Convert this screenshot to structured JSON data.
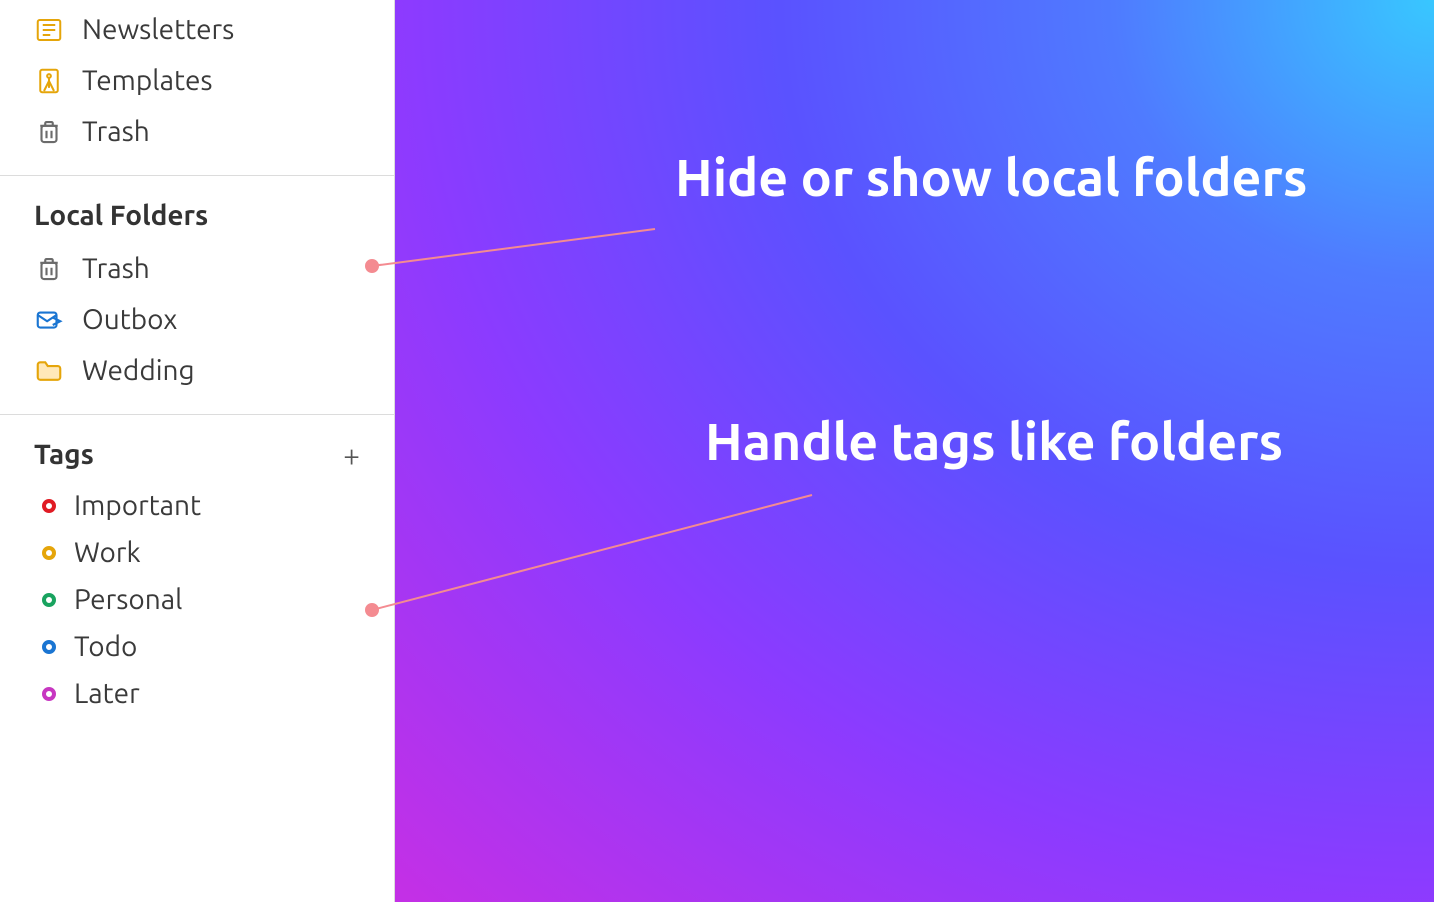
{
  "sidebar": {
    "top_items": [
      {
        "label": "Newsletters",
        "icon": "newsletter"
      },
      {
        "label": "Templates",
        "icon": "template"
      },
      {
        "label": "Trash",
        "icon": "trash"
      }
    ],
    "local_folders": {
      "title": "Local Folders",
      "items": [
        {
          "label": "Trash",
          "icon": "trash"
        },
        {
          "label": "Outbox",
          "icon": "outbox"
        },
        {
          "label": "Wedding",
          "icon": "folder"
        }
      ]
    },
    "tags": {
      "title": "Tags",
      "plus": "+",
      "items": [
        {
          "label": "Important",
          "color": "#e01b24"
        },
        {
          "label": "Work",
          "color": "#e5a50a"
        },
        {
          "label": "Personal",
          "color": "#19a35f"
        },
        {
          "label": "Todo",
          "color": "#1a75d2"
        },
        {
          "label": "Later",
          "color": "#c737c1"
        }
      ]
    }
  },
  "callouts": {
    "folders": "Hide or show local folders",
    "tags": "Handle tags like folders"
  },
  "connector_color": "#f48b91"
}
